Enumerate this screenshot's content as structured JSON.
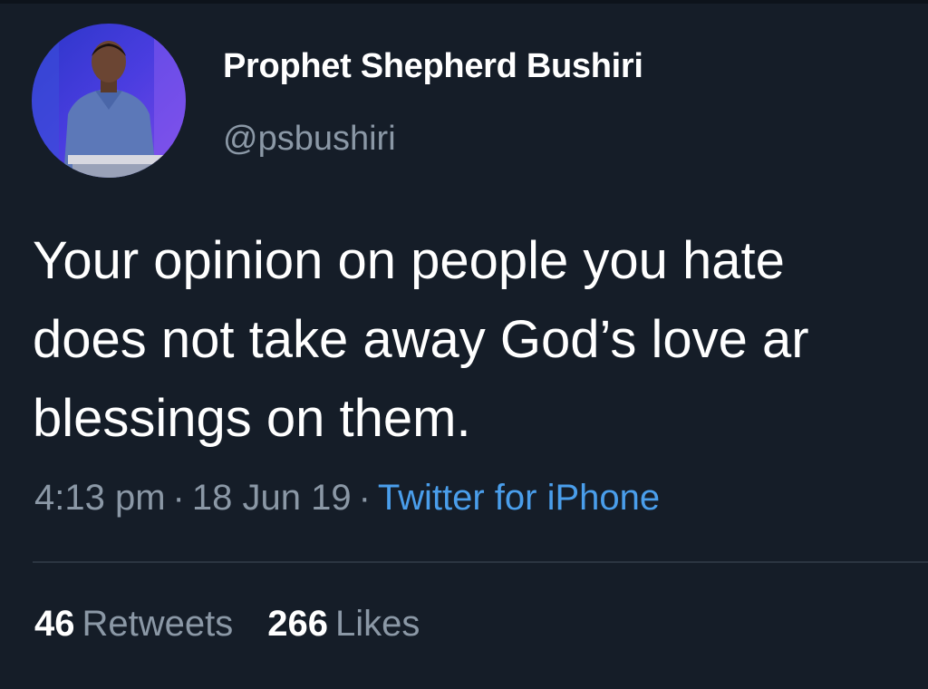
{
  "tweet": {
    "author": {
      "display_name": "Prophet Shepherd Bushiri",
      "handle": "@psbushiri"
    },
    "text_lines": [
      "Your opinion on people you hate",
      "does not take away God’s love ar",
      "blessings on them."
    ],
    "time": "4:13 pm",
    "separator": "·",
    "date": "18 Jun 19",
    "source": "Twitter for iPhone",
    "stats": {
      "retweets_count": "46",
      "retweets_label": "Retweets",
      "likes_count": "266",
      "likes_label": "Likes"
    }
  },
  "colors": {
    "background": "#151d28",
    "primary_text": "#ffffff",
    "secondary_text": "#8b98a6",
    "link": "#4a9eeb",
    "divider": "#2b3541"
  }
}
